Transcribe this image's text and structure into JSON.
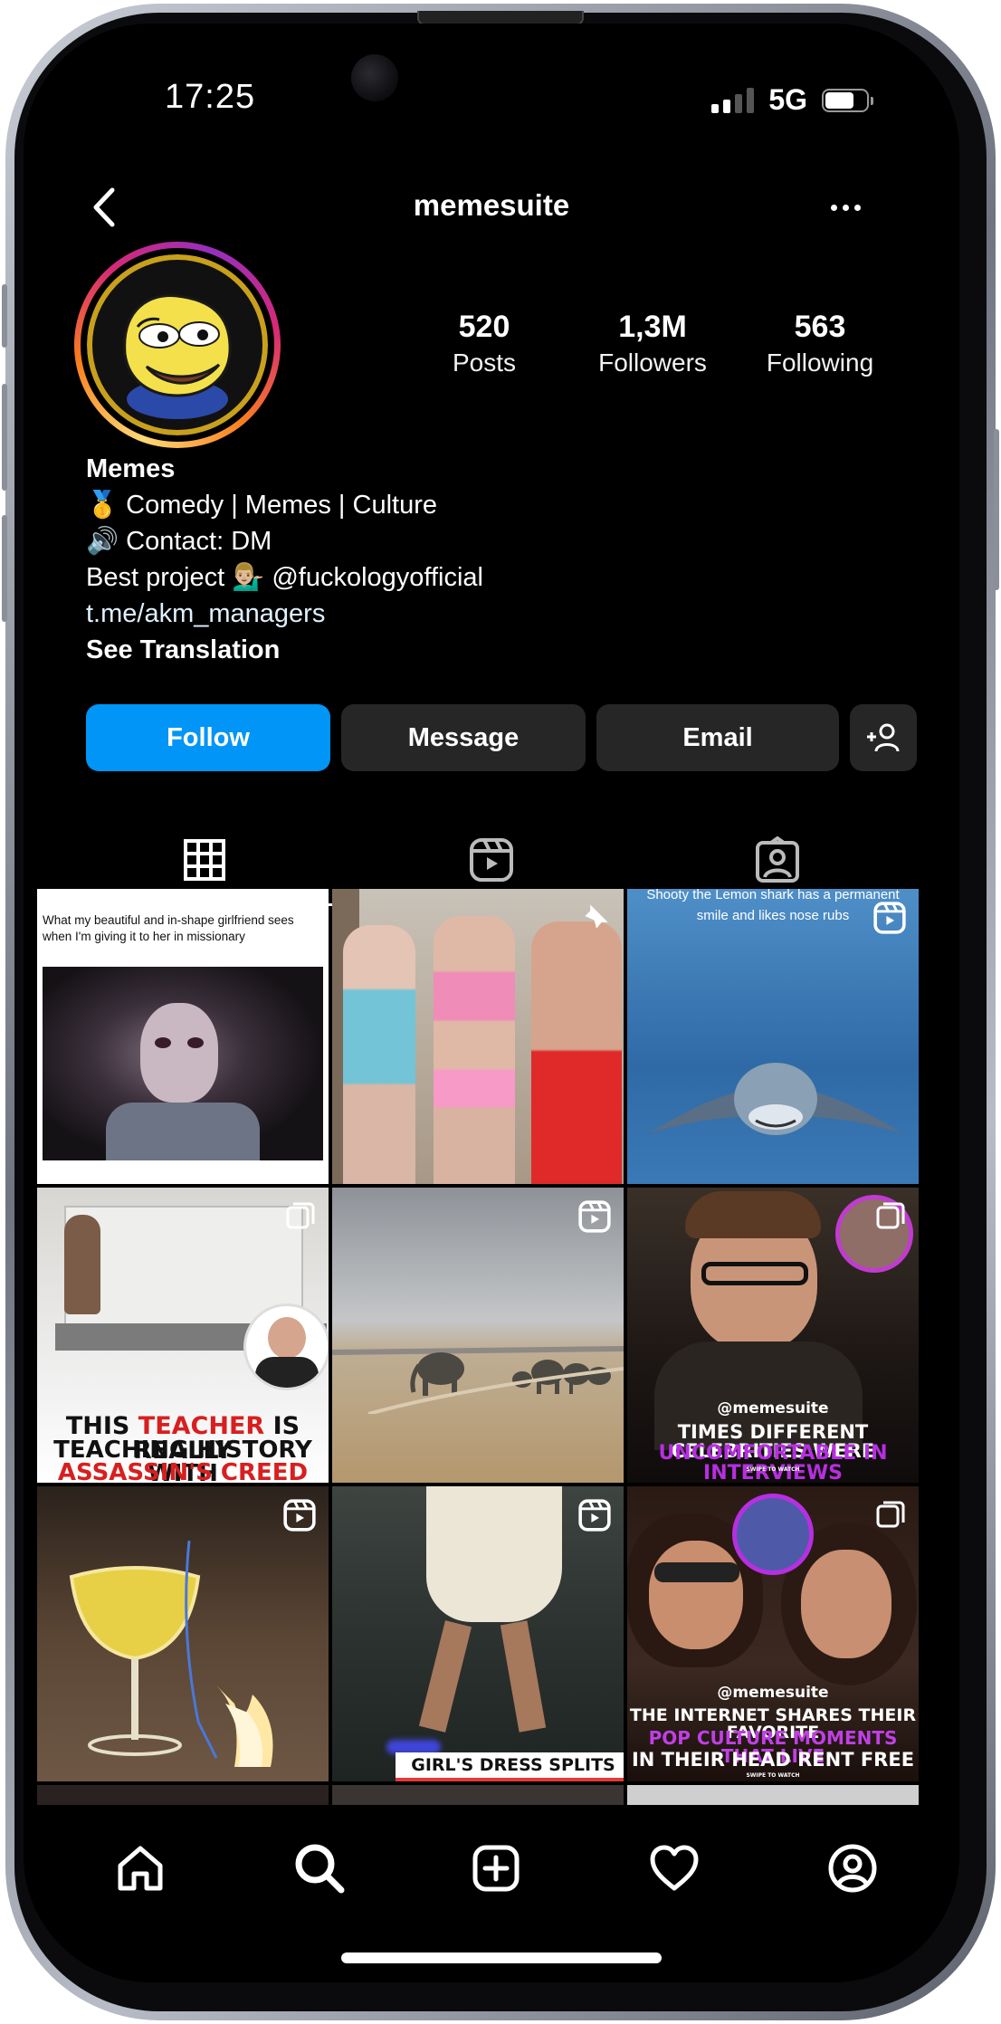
{
  "status": {
    "time": "17:25",
    "network": "5G"
  },
  "header": {
    "username": "memesuite"
  },
  "stats": [
    {
      "value": "520",
      "label": "Posts"
    },
    {
      "value": "1,3M",
      "label": "Followers"
    },
    {
      "value": "563",
      "label": "Following"
    }
  ],
  "bio": {
    "name": "Memes",
    "line1": "🥇 Comedy | Memes | Culture",
    "line2": "🔊 Contact: DM",
    "line3": "Best project 💁🏼‍♂️ @fuckologyofficial",
    "link": "t.me/akm_managers",
    "translate": "See Translation"
  },
  "actions": {
    "follow": "Follow",
    "message": "Message",
    "email": "Email"
  },
  "posts": [
    {
      "caption": "What my beautiful and in-shape girlfriend sees when I'm giving it to her in missionary",
      "badge": "pin-icon"
    },
    {
      "badge": "pin-icon"
    },
    {
      "caption": "Shooty the Lemon shark has a permanent smile and likes nose rubs",
      "badge": "reel-icon"
    },
    {
      "caption_a": "THIS",
      "caption_b": "TEACHER",
      "caption_c": "IS REALLY",
      "caption_d": "TEACHING HISTORY WITH",
      "caption_e": "ASSASSIN'S CREED",
      "badge": "carousel-icon"
    },
    {
      "badge": "reel-icon"
    },
    {
      "handle": "@memesuite",
      "caption_a": "TIMES DIFFERENT CELEBRITIES WERE",
      "caption_b": "UNCOMFORTABLE IN INTERVIEWS",
      "swipe": "SWIPE TO WATCH",
      "badge": "carousel-icon"
    },
    {
      "badge": "reel-icon"
    },
    {
      "caption": "GIRL'S DRESS SPLITS",
      "badge": "reel-icon"
    },
    {
      "handle": "@memesuite",
      "caption_a": "THE INTERNET SHARES THEIR FAVORITE",
      "caption_b": "POP CULTURE MOMENTS THAT LIVE",
      "caption_c": "IN THEIR HEAD RENT FREE",
      "swipe": "SWIPE TO WATCH",
      "badge": "carousel-icon"
    }
  ]
}
